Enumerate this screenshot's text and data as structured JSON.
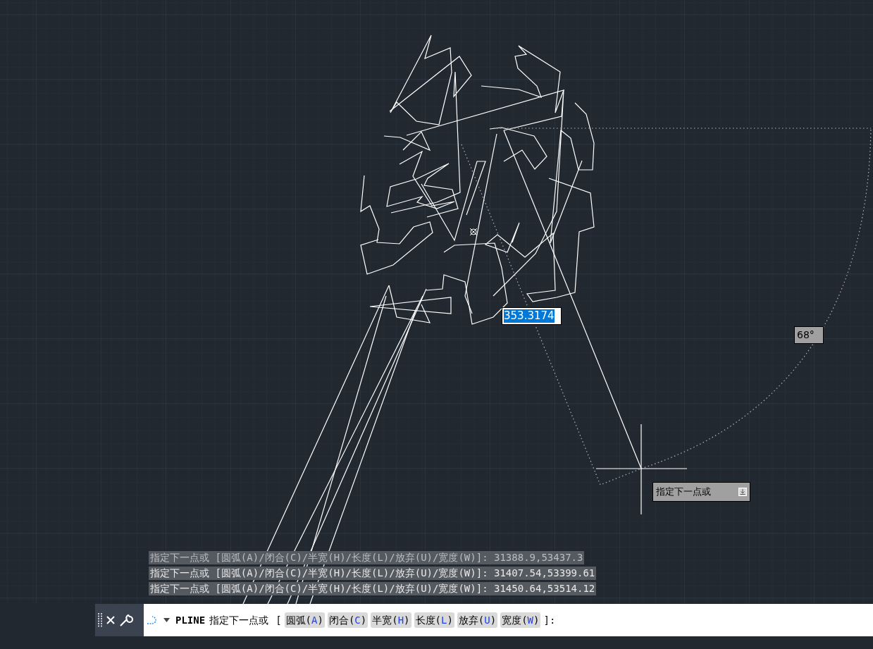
{
  "canvas": {
    "length_input": {
      "value": "353.3174"
    },
    "angle_label": "68°",
    "prompt_tooltip": "指定下一点或"
  },
  "history": [
    {
      "text": "指定下一点或 [圆弧(A)/闭合(C)/半宽(H)/长度(L)/放弃(U)/宽度(W)]: 31388.9,53437.3",
      "faded": true
    },
    {
      "text": "指定下一点或 [圆弧(A)/闭合(C)/半宽(H)/长度(L)/放弃(U)/宽度(W)]: 31407.54,53399.61",
      "faded": false
    },
    {
      "text": "指定下一点或 [圆弧(A)/闭合(C)/半宽(H)/长度(L)/放弃(U)/宽度(W)]: 31450.64,53514.12",
      "faded": false
    }
  ],
  "command_line": {
    "command": "PLINE",
    "prompt": "指定下一点或",
    "bracket_open": "[",
    "options": [
      {
        "label": "圆弧(",
        "key": "A",
        "end": ")"
      },
      {
        "label": "闭合(",
        "key": "C",
        "end": ")"
      },
      {
        "label": "半宽(",
        "key": "H",
        "end": ")"
      },
      {
        "label": "长度(",
        "key": "L",
        "end": ")"
      },
      {
        "label": "放弃(",
        "key": "U",
        "end": ")"
      },
      {
        "label": "宽度(",
        "key": "W",
        "end": ")"
      }
    ],
    "suffix": "]:"
  }
}
